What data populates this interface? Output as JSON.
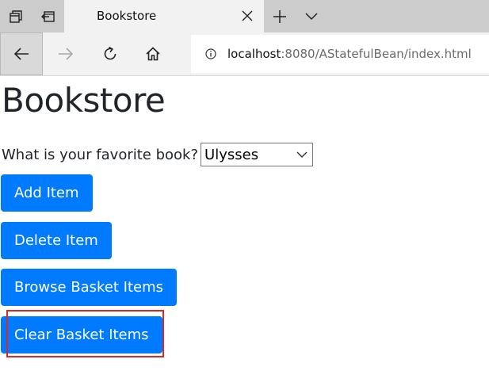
{
  "browser": {
    "tab": {
      "title": "Bookstore"
    },
    "address": {
      "host": "localhost",
      "rest": ":8080/AStatefulBean/index.html"
    }
  },
  "icons": {
    "tab_manager": "tab-manager-icon",
    "set_aside": "set-aside-tabs-icon",
    "close": "close-icon",
    "new_tab": "plus-icon",
    "tab_list": "chevron-down-icon",
    "back": "back-arrow-icon",
    "forward": "forward-arrow-icon",
    "refresh": "refresh-icon",
    "home": "home-icon",
    "site_info": "info-icon"
  },
  "page": {
    "title": "Bookstore",
    "question": "What is your favorite book?",
    "select": {
      "value": "Ulysses"
    },
    "buttons": {
      "add": "Add Item",
      "delete": "Delete Item",
      "browse": "Browse Basket Items",
      "clear": "Clear Basket Items"
    }
  },
  "colors": {
    "primary_button": "#007bff",
    "highlight": "#d92828",
    "tabbar": "#cccccc"
  }
}
